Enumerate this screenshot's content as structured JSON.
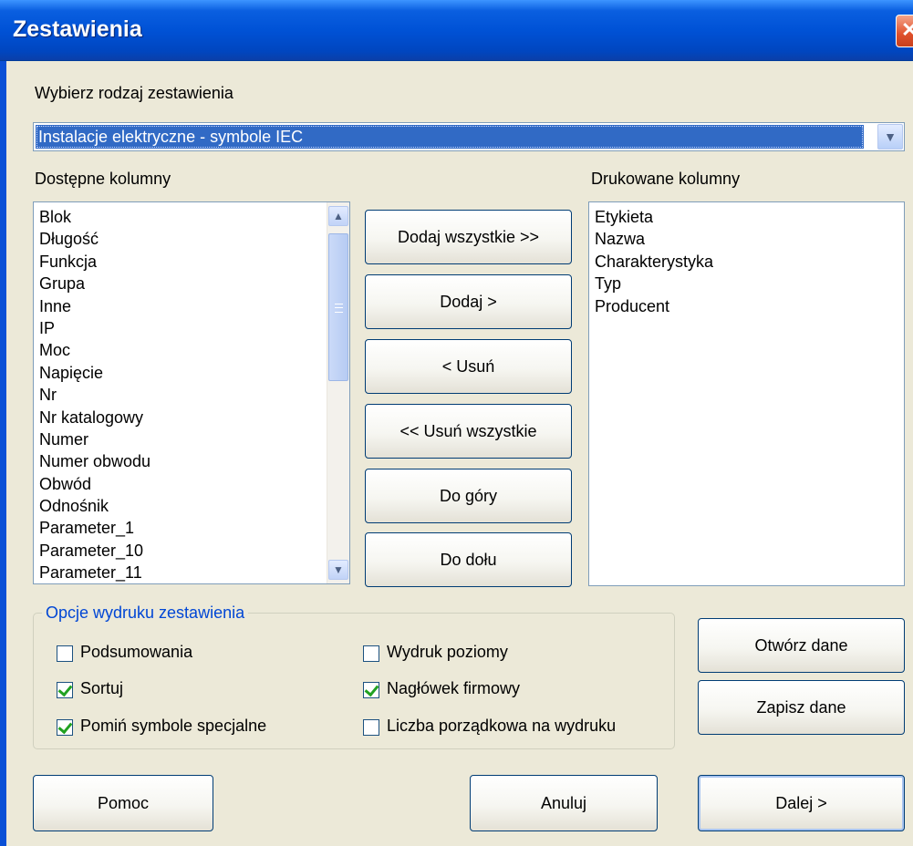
{
  "window": {
    "title": "Zestawienia",
    "close_glyph": "✕"
  },
  "report_type": {
    "label": "Wybierz rodzaj zestawienia",
    "selected": "Instalacje elektryczne - symbole IEC"
  },
  "available": {
    "label": "Dostępne kolumny",
    "items": [
      "Blok",
      "Długość",
      "Funkcja",
      "Grupa",
      "Inne",
      "IP",
      "Moc",
      "Napięcie",
      "Nr",
      "Nr katalogowy",
      "Numer",
      "Numer obwodu",
      "Obwód",
      "Odnośnik",
      "Parameter_1",
      "Parameter_10",
      "Parameter_11"
    ]
  },
  "printed": {
    "label": "Drukowane kolumny",
    "items": [
      "Etykieta",
      "Nazwa",
      "Charakterystyka",
      "Typ",
      "Producent"
    ]
  },
  "actions": {
    "add_all": "Dodaj wszystkie >>",
    "add": "Dodaj >",
    "remove": "< Usuń",
    "remove_all": "<< Usuń wszystkie",
    "up": "Do góry",
    "down": "Do dołu"
  },
  "options": {
    "legend": "Opcje wydruku zestawienia",
    "summary": {
      "label": "Podsumowania",
      "checked": false
    },
    "sort": {
      "label": "Sortuj",
      "checked": true
    },
    "skip_special": {
      "label": "Pomiń symbole specjalne",
      "checked": true
    },
    "landscape": {
      "label": "Wydruk poziomy",
      "checked": false
    },
    "company_header": {
      "label": "Nagłówek firmowy",
      "checked": true
    },
    "ordinal": {
      "label": "Liczba porządkowa na wydruku",
      "checked": false
    }
  },
  "data_buttons": {
    "open": "Otwórz dane",
    "save": "Zapisz dane"
  },
  "footer": {
    "help": "Pomoc",
    "cancel": "Anuluj",
    "next": "Dalej >"
  },
  "icons": {
    "dropdown": "chevron-down-icon",
    "scroll_up": "scroll-up-arrow-icon",
    "scroll_down": "scroll-down-arrow-icon",
    "check": "checkmark-icon"
  },
  "colors": {
    "title_bar": "#0052d6",
    "selection": "#316ac5",
    "group_legend": "#0046d5",
    "window_bg": "#ece9d8"
  }
}
